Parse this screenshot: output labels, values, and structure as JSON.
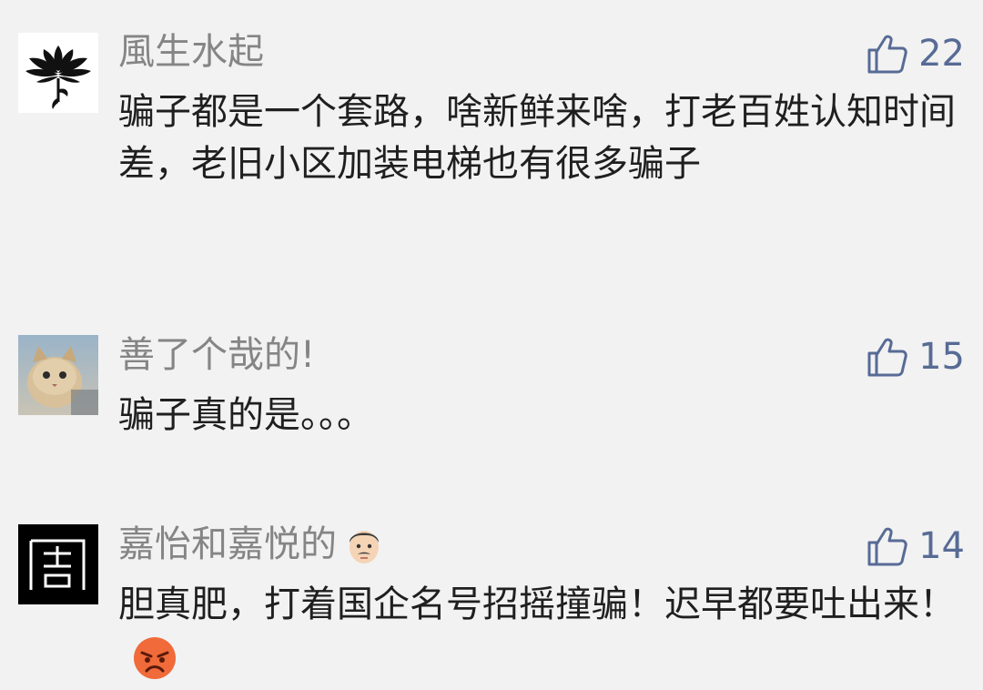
{
  "comments": [
    {
      "nickname": "風生水起",
      "likes": "22",
      "content": "骗子都是一个套路，啥新鲜来啥，打老百姓认知时间差，老旧小区加装电梯也有很多骗子",
      "avatar_icon": "lotus-icon"
    },
    {
      "nickname": "善了个哉的!",
      "likes": "15",
      "content": "骗子真的是。。。",
      "avatar_icon": "cat-photo"
    },
    {
      "nickname": "嘉怡和嘉悦的",
      "likes": "14",
      "content": "胆真肥，打着国企名号招摇撞骗！迟早都要吐出来！",
      "avatar_icon": "seal-icon",
      "nickname_emoji": "man-face-emoji",
      "content_emoji": "angry-face-emoji"
    }
  ],
  "colors": {
    "background": "#f2f2f2",
    "nickname": "#858585",
    "content": "#1f1f1f",
    "like": "#576b95"
  }
}
